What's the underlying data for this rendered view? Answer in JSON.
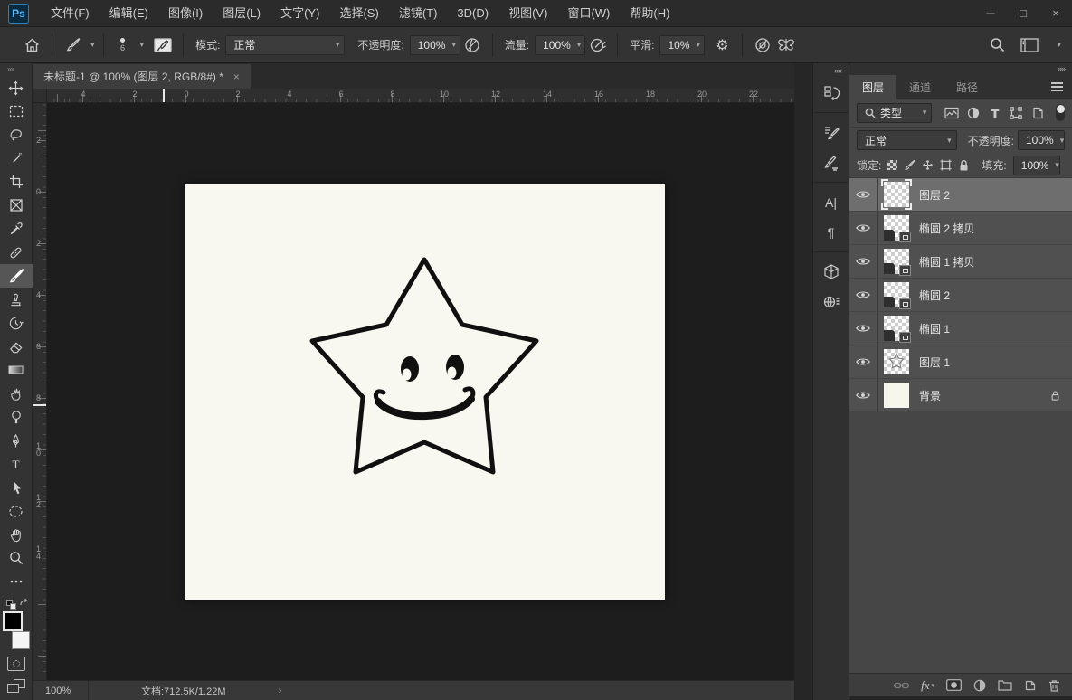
{
  "titlebar": {
    "logo": "Ps",
    "menus": [
      "文件(F)",
      "编辑(E)",
      "图像(I)",
      "图层(L)",
      "文字(Y)",
      "选择(S)",
      "滤镜(T)",
      "3D(D)",
      "视图(V)",
      "窗口(W)",
      "帮助(H)"
    ],
    "minimize": "─",
    "maximize": "□",
    "close": "×"
  },
  "optionsbar": {
    "brush_size": "6",
    "mode_label": "模式:",
    "mode_value": "正常",
    "opacity_label": "不透明度:",
    "opacity_value": "100%",
    "flow_label": "流量:",
    "flow_value": "100%",
    "smoothing_label": "平滑:",
    "smoothing_value": "10%",
    "gear": "⚙"
  },
  "ui": {
    "chevron": "▾",
    "collapse_left": "««",
    "collapse_right": "»»"
  },
  "document": {
    "tab_title": "未标题-1 @ 100% (图层 2, RGB/8#) *",
    "tab_close": "×",
    "h_ruler": [
      "4",
      "2",
      "0",
      "2",
      "4",
      "6",
      "8",
      "10",
      "12",
      "14",
      "16",
      "18",
      "20",
      "22"
    ],
    "v_ruler": [
      "2",
      "0",
      "2",
      "4",
      "6",
      "8",
      "10",
      "12",
      "14"
    ],
    "zoom": "100%",
    "doc_info": "文档:712.5K/1.22M",
    "status_chevron": "›"
  },
  "canvas": {
    "background": "#f8f8f1",
    "ink": "#101010",
    "drawing": "smiley-star"
  },
  "layers_panel": {
    "tabs": [
      "图层",
      "通道",
      "路径"
    ],
    "active_tab": "图层",
    "filter_value": "类型",
    "blend_mode": "正常",
    "opacity_label": "不透明度:",
    "opacity_value": "100%",
    "lock_label": "锁定:",
    "fill_label": "填充:",
    "fill_value": "100%",
    "rows": [
      {
        "name": "图层 2",
        "selected": true,
        "type": "pixel"
      },
      {
        "name": "椭圆 2 拷贝",
        "selected": false,
        "type": "shape"
      },
      {
        "name": "椭圆 1 拷贝",
        "selected": false,
        "type": "shape"
      },
      {
        "name": "椭圆 2",
        "selected": false,
        "type": "shape"
      },
      {
        "name": "椭圆 1",
        "selected": false,
        "type": "shape"
      },
      {
        "name": "图层 1",
        "selected": false,
        "type": "pixel"
      },
      {
        "name": "背景",
        "selected": false,
        "type": "background",
        "locked": true
      }
    ]
  }
}
